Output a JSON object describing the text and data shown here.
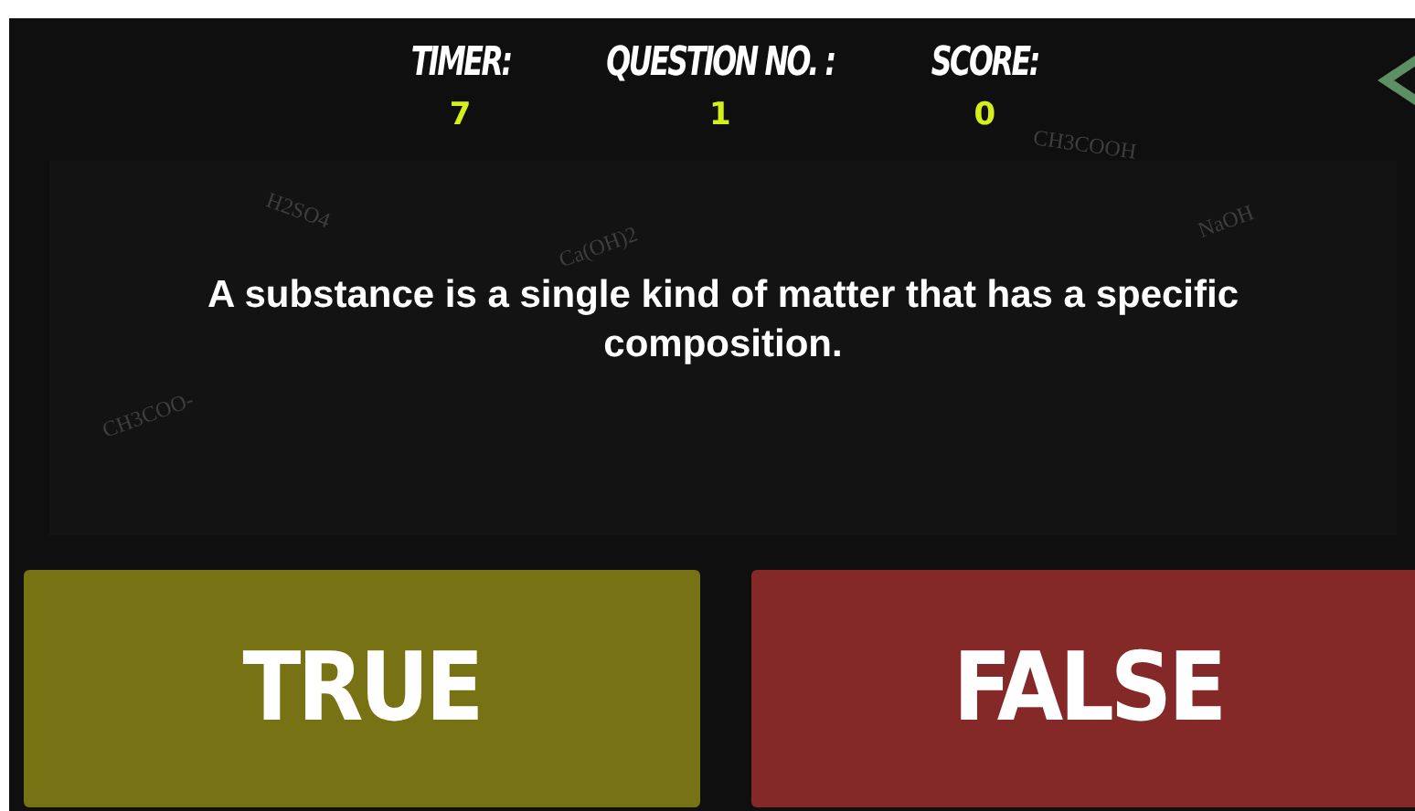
{
  "header": {
    "stats": [
      {
        "label": "TIMER:",
        "value": "7"
      },
      {
        "label": "QUESTION NO. :",
        "value": "1"
      },
      {
        "label": "SCORE:",
        "value": "0"
      }
    ]
  },
  "background_formulas": [
    "H2SO4",
    "Ca(OH)2",
    "NaOH",
    "CH3COOH",
    "CH3COO-"
  ],
  "question": {
    "text": "A substance is a single kind of matter that has a specific composition."
  },
  "answers": [
    {
      "label": "TRUE",
      "color": "#777214"
    },
    {
      "label": "FALSE",
      "color": "#842828"
    }
  ]
}
